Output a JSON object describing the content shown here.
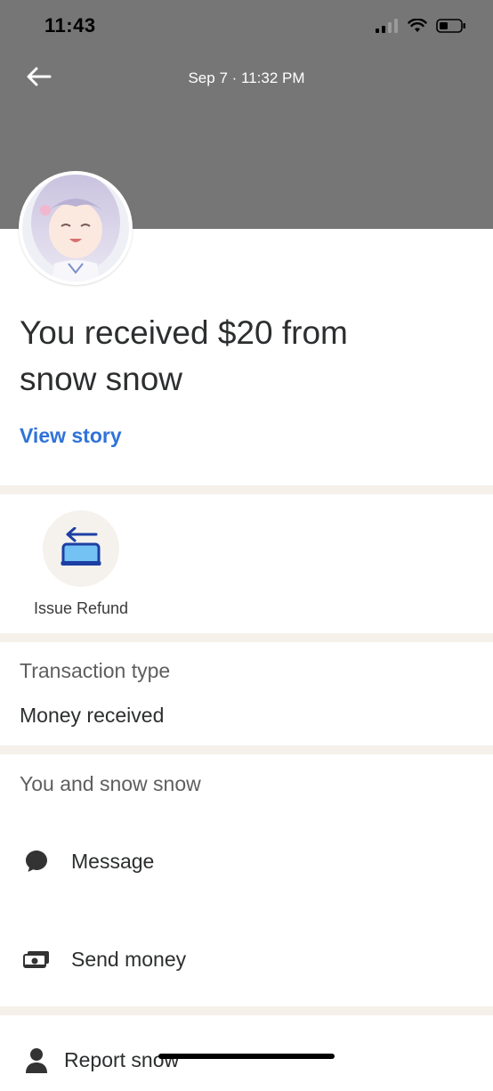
{
  "status_bar": {
    "time": "11:43"
  },
  "nav": {
    "title": "Sep 7 · 11:32 PM"
  },
  "headline": {
    "line1": "You received $20 from",
    "line2": "snow snow"
  },
  "view_story_label": "View story",
  "actions": {
    "refund_label": "Issue Refund"
  },
  "transaction": {
    "label": "Transaction type",
    "value": "Money received"
  },
  "contact": {
    "heading": "You and snow snow",
    "items": [
      {
        "label": "Message",
        "icon": "chat-bubble-icon"
      },
      {
        "label": "Send money",
        "icon": "cash-icon"
      },
      {
        "label": "Report snow",
        "icon": "person-icon"
      }
    ]
  },
  "colors": {
    "header": "#767676",
    "link": "#2f73d8",
    "divider": "#f5f1ea",
    "refund_icon": "#1d3fa4"
  }
}
